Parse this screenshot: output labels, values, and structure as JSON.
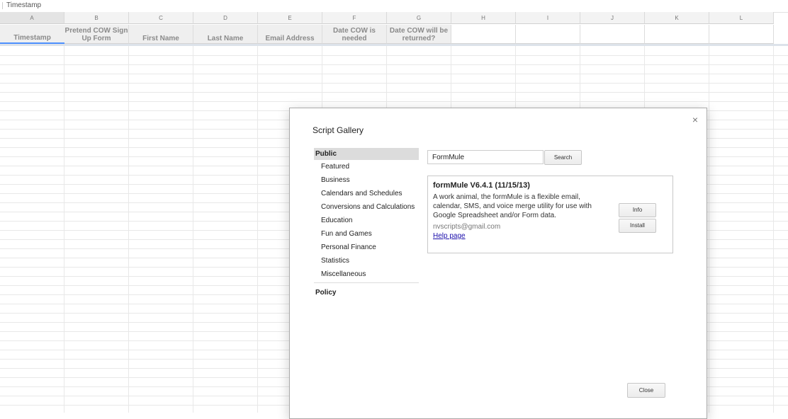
{
  "formula_bar": {
    "value": "Timestamp"
  },
  "columns": [
    "A",
    "B",
    "C",
    "D",
    "E",
    "F",
    "G",
    "H",
    "I",
    "J",
    "K",
    "L"
  ],
  "header_row": [
    "Timestamp",
    "Pretend COW Sign Up Form",
    "First Name",
    "Last Name",
    "Email Address",
    "Date COW is needed",
    "Date COW will be returned?",
    "",
    "",
    "",
    "",
    ""
  ],
  "dialog": {
    "title": "Script Gallery",
    "close_symbol": "×",
    "sidebar": {
      "public_label": "Public",
      "items": [
        "Featured",
        "Business",
        "Calendars and Schedules",
        "Conversions and Calculations",
        "Education",
        "Fun and Games",
        "Personal Finance",
        "Statistics",
        "Miscellaneous"
      ],
      "policy_label": "Policy"
    },
    "search": {
      "value": "FormMule",
      "button_label": "Search"
    },
    "result": {
      "title": "formMule V6.4.1 (11/15/13)",
      "description": "A work animal, the formMule is a flexible email, calendar, SMS, and voice merge utility for use with Google Spreadsheet and/or Form data.",
      "author_email": "nvscripts@gmail.com",
      "help_link": "Help page",
      "info_button": "Info",
      "install_button": "Install"
    },
    "close_button": "Close"
  }
}
